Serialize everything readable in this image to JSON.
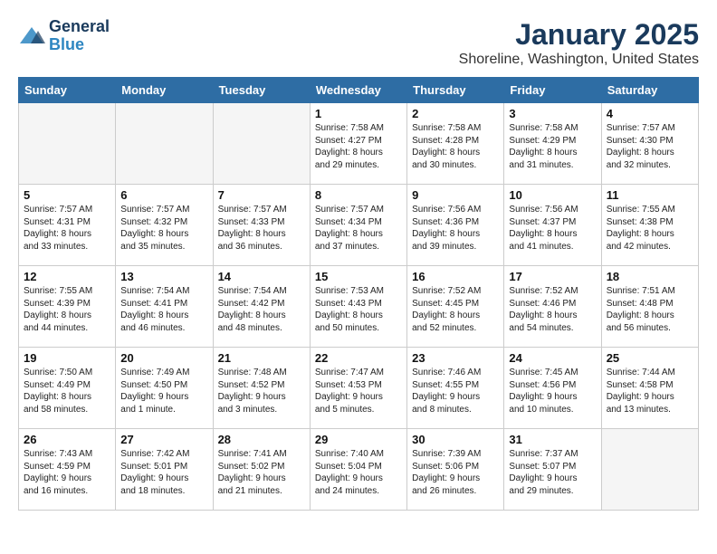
{
  "header": {
    "logo_line1": "General",
    "logo_line2": "Blue",
    "title": "January 2025",
    "subtitle": "Shoreline, Washington, United States"
  },
  "weekdays": [
    "Sunday",
    "Monday",
    "Tuesday",
    "Wednesday",
    "Thursday",
    "Friday",
    "Saturday"
  ],
  "weeks": [
    [
      {
        "day": "",
        "info": "",
        "empty": true
      },
      {
        "day": "",
        "info": "",
        "empty": true
      },
      {
        "day": "",
        "info": "",
        "empty": true
      },
      {
        "day": "1",
        "info": "Sunrise: 7:58 AM\nSunset: 4:27 PM\nDaylight: 8 hours\nand 29 minutes.",
        "empty": false
      },
      {
        "day": "2",
        "info": "Sunrise: 7:58 AM\nSunset: 4:28 PM\nDaylight: 8 hours\nand 30 minutes.",
        "empty": false
      },
      {
        "day": "3",
        "info": "Sunrise: 7:58 AM\nSunset: 4:29 PM\nDaylight: 8 hours\nand 31 minutes.",
        "empty": false
      },
      {
        "day": "4",
        "info": "Sunrise: 7:57 AM\nSunset: 4:30 PM\nDaylight: 8 hours\nand 32 minutes.",
        "empty": false
      }
    ],
    [
      {
        "day": "5",
        "info": "Sunrise: 7:57 AM\nSunset: 4:31 PM\nDaylight: 8 hours\nand 33 minutes.",
        "empty": false
      },
      {
        "day": "6",
        "info": "Sunrise: 7:57 AM\nSunset: 4:32 PM\nDaylight: 8 hours\nand 35 minutes.",
        "empty": false
      },
      {
        "day": "7",
        "info": "Sunrise: 7:57 AM\nSunset: 4:33 PM\nDaylight: 8 hours\nand 36 minutes.",
        "empty": false
      },
      {
        "day": "8",
        "info": "Sunrise: 7:57 AM\nSunset: 4:34 PM\nDaylight: 8 hours\nand 37 minutes.",
        "empty": false
      },
      {
        "day": "9",
        "info": "Sunrise: 7:56 AM\nSunset: 4:36 PM\nDaylight: 8 hours\nand 39 minutes.",
        "empty": false
      },
      {
        "day": "10",
        "info": "Sunrise: 7:56 AM\nSunset: 4:37 PM\nDaylight: 8 hours\nand 41 minutes.",
        "empty": false
      },
      {
        "day": "11",
        "info": "Sunrise: 7:55 AM\nSunset: 4:38 PM\nDaylight: 8 hours\nand 42 minutes.",
        "empty": false
      }
    ],
    [
      {
        "day": "12",
        "info": "Sunrise: 7:55 AM\nSunset: 4:39 PM\nDaylight: 8 hours\nand 44 minutes.",
        "empty": false
      },
      {
        "day": "13",
        "info": "Sunrise: 7:54 AM\nSunset: 4:41 PM\nDaylight: 8 hours\nand 46 minutes.",
        "empty": false
      },
      {
        "day": "14",
        "info": "Sunrise: 7:54 AM\nSunset: 4:42 PM\nDaylight: 8 hours\nand 48 minutes.",
        "empty": false
      },
      {
        "day": "15",
        "info": "Sunrise: 7:53 AM\nSunset: 4:43 PM\nDaylight: 8 hours\nand 50 minutes.",
        "empty": false
      },
      {
        "day": "16",
        "info": "Sunrise: 7:52 AM\nSunset: 4:45 PM\nDaylight: 8 hours\nand 52 minutes.",
        "empty": false
      },
      {
        "day": "17",
        "info": "Sunrise: 7:52 AM\nSunset: 4:46 PM\nDaylight: 8 hours\nand 54 minutes.",
        "empty": false
      },
      {
        "day": "18",
        "info": "Sunrise: 7:51 AM\nSunset: 4:48 PM\nDaylight: 8 hours\nand 56 minutes.",
        "empty": false
      }
    ],
    [
      {
        "day": "19",
        "info": "Sunrise: 7:50 AM\nSunset: 4:49 PM\nDaylight: 8 hours\nand 58 minutes.",
        "empty": false
      },
      {
        "day": "20",
        "info": "Sunrise: 7:49 AM\nSunset: 4:50 PM\nDaylight: 9 hours\nand 1 minute.",
        "empty": false
      },
      {
        "day": "21",
        "info": "Sunrise: 7:48 AM\nSunset: 4:52 PM\nDaylight: 9 hours\nand 3 minutes.",
        "empty": false
      },
      {
        "day": "22",
        "info": "Sunrise: 7:47 AM\nSunset: 4:53 PM\nDaylight: 9 hours\nand 5 minutes.",
        "empty": false
      },
      {
        "day": "23",
        "info": "Sunrise: 7:46 AM\nSunset: 4:55 PM\nDaylight: 9 hours\nand 8 minutes.",
        "empty": false
      },
      {
        "day": "24",
        "info": "Sunrise: 7:45 AM\nSunset: 4:56 PM\nDaylight: 9 hours\nand 10 minutes.",
        "empty": false
      },
      {
        "day": "25",
        "info": "Sunrise: 7:44 AM\nSunset: 4:58 PM\nDaylight: 9 hours\nand 13 minutes.",
        "empty": false
      }
    ],
    [
      {
        "day": "26",
        "info": "Sunrise: 7:43 AM\nSunset: 4:59 PM\nDaylight: 9 hours\nand 16 minutes.",
        "empty": false
      },
      {
        "day": "27",
        "info": "Sunrise: 7:42 AM\nSunset: 5:01 PM\nDaylight: 9 hours\nand 18 minutes.",
        "empty": false
      },
      {
        "day": "28",
        "info": "Sunrise: 7:41 AM\nSunset: 5:02 PM\nDaylight: 9 hours\nand 21 minutes.",
        "empty": false
      },
      {
        "day": "29",
        "info": "Sunrise: 7:40 AM\nSunset: 5:04 PM\nDaylight: 9 hours\nand 24 minutes.",
        "empty": false
      },
      {
        "day": "30",
        "info": "Sunrise: 7:39 AM\nSunset: 5:06 PM\nDaylight: 9 hours\nand 26 minutes.",
        "empty": false
      },
      {
        "day": "31",
        "info": "Sunrise: 7:37 AM\nSunset: 5:07 PM\nDaylight: 9 hours\nand 29 minutes.",
        "empty": false
      },
      {
        "day": "",
        "info": "",
        "empty": true
      }
    ]
  ]
}
